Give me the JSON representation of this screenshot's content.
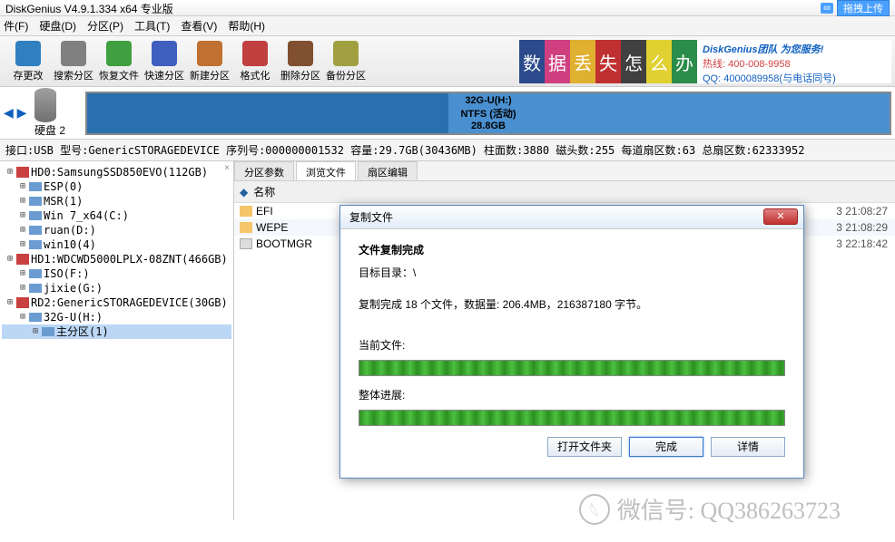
{
  "title": "DiskGenius V4.9.1.334 x64 专业版",
  "upload": {
    "icon": "∞",
    "text": "拖拽上传"
  },
  "menu": [
    "件(F)",
    "硬盘(D)",
    "分区(P)",
    "工具(T)",
    "查看(V)",
    "帮助(H)"
  ],
  "toolbar": [
    {
      "label": "存更改",
      "color": "#3080c0"
    },
    {
      "label": "搜索分区",
      "color": "#808080"
    },
    {
      "label": "恢复文件",
      "color": "#40a040"
    },
    {
      "label": "快速分区",
      "color": "#4060c0"
    },
    {
      "label": "新建分区",
      "color": "#c07030"
    },
    {
      "label": "格式化",
      "color": "#c04040"
    },
    {
      "label": "删除分区",
      "color": "#805030"
    },
    {
      "label": "备份分区",
      "color": "#a0a040"
    }
  ],
  "banner": {
    "chars": [
      {
        "t": "数",
        "bg": "#2c4a8c"
      },
      {
        "t": "据",
        "bg": "#d04080"
      },
      {
        "t": "丢",
        "bg": "#e0b030"
      },
      {
        "t": "失",
        "bg": "#c03030"
      },
      {
        "t": "怎",
        "bg": "#404040"
      },
      {
        "t": "么",
        "bg": "#e0d030"
      },
      {
        "t": "办",
        "bg": "#2c8c4a"
      }
    ],
    "line1": "DiskGenius团队 为您服务!",
    "line2": "热线: 400-008-9958",
    "line3": "QQ: 4000089958(与电话同号)"
  },
  "diskmap": {
    "nav": "◀ ▶",
    "disk_label": "硬盘 2",
    "part_name": "32G-U(H:)",
    "part_fs": "NTFS (活动)",
    "part_size": "28.8GB"
  },
  "status": "接口:USB  型号:GenericSTORAGEDEVICE  序列号:000000001532  容量:29.7GB(30436MB)  柱面数:3880  磁头数:255  每道扇区数:63  总扇区数:62333952",
  "tree": [
    {
      "t": "HD0:SamsungSSD850EVO(112GB)",
      "lvl": 0,
      "kind": "disk"
    },
    {
      "t": "ESP(0)",
      "lvl": 1,
      "kind": "part"
    },
    {
      "t": "MSR(1)",
      "lvl": 1,
      "kind": "part"
    },
    {
      "t": "Win 7_x64(C:)",
      "lvl": 1,
      "kind": "part"
    },
    {
      "t": "ruan(D:)",
      "lvl": 1,
      "kind": "part"
    },
    {
      "t": "win10(4)",
      "lvl": 1,
      "kind": "part"
    },
    {
      "t": "HD1:WDCWD5000LPLX-08ZNT(466GB)",
      "lvl": 0,
      "kind": "disk"
    },
    {
      "t": "ISO(F:)",
      "lvl": 1,
      "kind": "part"
    },
    {
      "t": "jixie(G:)",
      "lvl": 1,
      "kind": "part"
    },
    {
      "t": "RD2:GenericSTORAGEDEVICE(30GB)",
      "lvl": 0,
      "kind": "disk"
    },
    {
      "t": "32G-U(H:)",
      "lvl": 1,
      "kind": "part"
    },
    {
      "t": "主分区(1)",
      "lvl": 2,
      "kind": "part",
      "sel": true
    }
  ],
  "tabs": [
    "分区参数",
    "浏览文件",
    "扇区编辑"
  ],
  "file_head": {
    "up": "◆",
    "name": "名称"
  },
  "files": [
    {
      "name": "EFI",
      "kind": "folder",
      "time": "3 21:08:27"
    },
    {
      "name": "WEPE",
      "kind": "folder",
      "time": "3 21:08:29"
    },
    {
      "name": "BOOTMGR",
      "kind": "file",
      "time": "3 22:18:42"
    }
  ],
  "dialog": {
    "title": "复制文件",
    "done": "文件复制完成",
    "target_label": "目标目录：\\",
    "summary": "复制完成 18 个文件，数据量: 206.4MB，216387180 字节。",
    "cur_label": "当前文件:",
    "prog_label": "整体进展:",
    "btn_open": "打开文件夹",
    "btn_done": "完成",
    "btn_detail": "详情"
  },
  "watermark": "微信号: QQ386263723"
}
